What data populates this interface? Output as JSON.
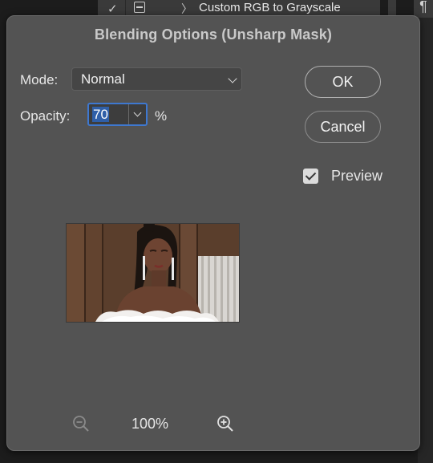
{
  "background": {
    "layer_label": "Custom RGB to Grayscale",
    "check_glyph": "✓",
    "chevron_glyph": "〉",
    "pilcrow_glyph": "¶"
  },
  "dialog": {
    "title": "Blending Options (Unsharp Mask)",
    "mode": {
      "label": "Mode:",
      "value": "Normal"
    },
    "opacity": {
      "label": "Opacity:",
      "value": "70",
      "unit": "%"
    },
    "buttons": {
      "ok": "OK",
      "cancel": "Cancel"
    },
    "preview": {
      "label": "Preview",
      "checked": true
    },
    "zoom": {
      "value": "100%"
    }
  },
  "colors": {
    "dialog_bg": "#535353",
    "focus_ring": "#3e78d0",
    "selection": "#2f5fa8"
  }
}
